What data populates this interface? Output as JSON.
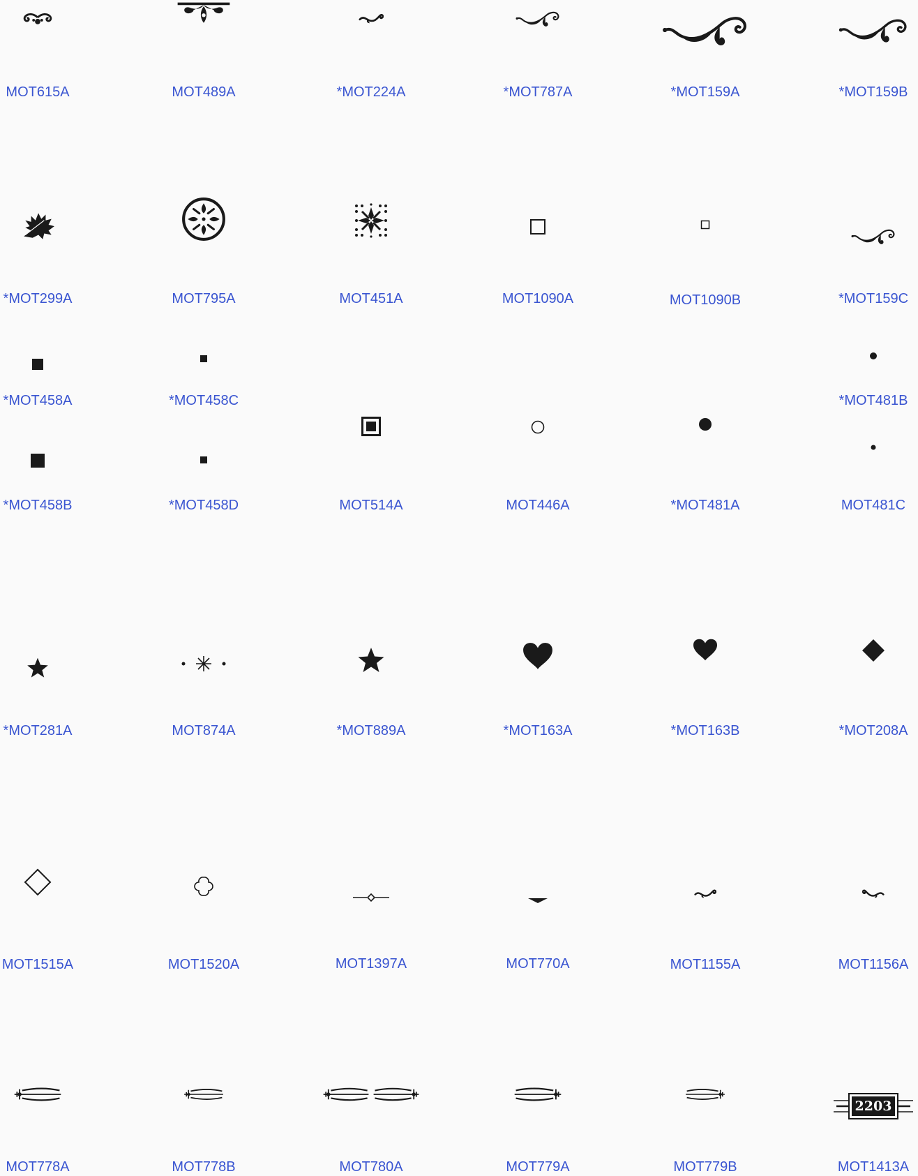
{
  "items": [
    {
      "code": "MOT615A",
      "icon": "ornament-scroll-icon"
    },
    {
      "code": "MOT489A",
      "icon": "crest-ornament-icon"
    },
    {
      "code": "*MOT224A",
      "icon": "small-flourish-icon"
    },
    {
      "code": "*MOT787A",
      "icon": "flourish-icon"
    },
    {
      "code": "*MOT159A",
      "icon": "large-flourish-icon"
    },
    {
      "code": "*MOT159B",
      "icon": "flourish-icon"
    },
    {
      "code": "*MOT299A",
      "icon": "maple-leaf-icon"
    },
    {
      "code": "MOT795A",
      "icon": "circle-medallion-icon"
    },
    {
      "code": "MOT451A",
      "icon": "snowflake-ornament-icon"
    },
    {
      "code": "MOT1090A",
      "icon": "square-outline-icon"
    },
    {
      "code": "MOT1090B",
      "icon": "small-square-outline-icon"
    },
    {
      "code": "*MOT159C",
      "icon": "small-flourish-icon"
    },
    {
      "code": "*MOT458A",
      "icon": "filled-square-icon"
    },
    {
      "code": "*MOT458C",
      "icon": "small-filled-square-icon"
    },
    {
      "code": "*MOT481B",
      "icon": "dot-icon"
    },
    {
      "code": "*MOT458B",
      "icon": "filled-square-icon"
    },
    {
      "code": "*MOT458D",
      "icon": "small-filled-square-icon"
    },
    {
      "code": "MOT514A",
      "icon": "framed-square-icon"
    },
    {
      "code": "MOT446A",
      "icon": "circle-outline-icon"
    },
    {
      "code": "*MOT481A",
      "icon": "filled-circle-icon"
    },
    {
      "code": "MOT481C",
      "icon": "dot-icon"
    },
    {
      "code": "*MOT281A",
      "icon": "star-icon"
    },
    {
      "code": "MOT874A",
      "icon": "asterisk-divider-icon"
    },
    {
      "code": "*MOT889A",
      "icon": "star-icon"
    },
    {
      "code": "*MOT163A",
      "icon": "heart-icon"
    },
    {
      "code": "*MOT163B",
      "icon": "heart-icon"
    },
    {
      "code": "*MOT208A",
      "icon": "diamond-icon"
    },
    {
      "code": "MOT1515A",
      "icon": "diamond-outline-icon"
    },
    {
      "code": "MOT1520A",
      "icon": "quatrefoil-outline-icon"
    },
    {
      "code": "MOT1397A",
      "icon": "line-diamond-divider-icon"
    },
    {
      "code": "MOT770A",
      "icon": "pointed-bar-icon"
    },
    {
      "code": "MOT1155A",
      "icon": "tiny-flourish-icon"
    },
    {
      "code": "MOT1156A",
      "icon": "tiny-flourish-icon"
    },
    {
      "code": "MOT778A",
      "icon": "scroll-divider-icon"
    },
    {
      "code": "MOT778B",
      "icon": "scroll-divider-icon"
    },
    {
      "code": "MOT780A",
      "icon": "double-scroll-divider-icon"
    },
    {
      "code": "MOT779A",
      "icon": "scroll-divider-icon"
    },
    {
      "code": "MOT779B",
      "icon": "scroll-divider-icon"
    },
    {
      "code": "MOT1413A",
      "icon": "address-plaque-icon",
      "plaque_text": "2203"
    }
  ],
  "colors": {
    "link": "#3a55d1",
    "ink": "#1a1a1a",
    "background": "#fafafa"
  }
}
